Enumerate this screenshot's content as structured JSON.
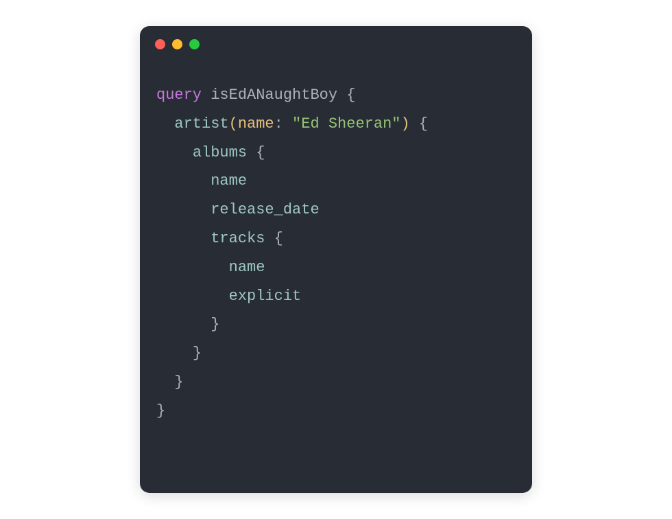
{
  "colors": {
    "bg": "#282c34",
    "keyword": "#c678dd",
    "default": "#abb2bf",
    "field": "#9ec7c2",
    "arg": "#e5c07b",
    "string": "#98c379",
    "red": "#ff5f56",
    "yellow": "#ffbd2e",
    "green": "#27c93f"
  },
  "code": {
    "line1": {
      "keyword": "query",
      "name": "isEdANaughtBoy",
      "brace": "{"
    },
    "line2": {
      "field": "artist",
      "lparen": "(",
      "arg": "name",
      "colon": ":",
      "string": "\"Ed Sheeran\"",
      "rparen": ")",
      "brace": "{"
    },
    "line3": {
      "field": "albums",
      "brace": "{"
    },
    "line4": {
      "field": "name"
    },
    "line5": {
      "field": "release_date"
    },
    "line6": {
      "field": "tracks",
      "brace": "{"
    },
    "line7": {
      "field": "name"
    },
    "line8": {
      "field": "explicit"
    },
    "line9": {
      "brace": "}"
    },
    "line10": {
      "brace": "}"
    },
    "line11": {
      "brace": "}"
    },
    "line12": {
      "brace": "}"
    }
  }
}
